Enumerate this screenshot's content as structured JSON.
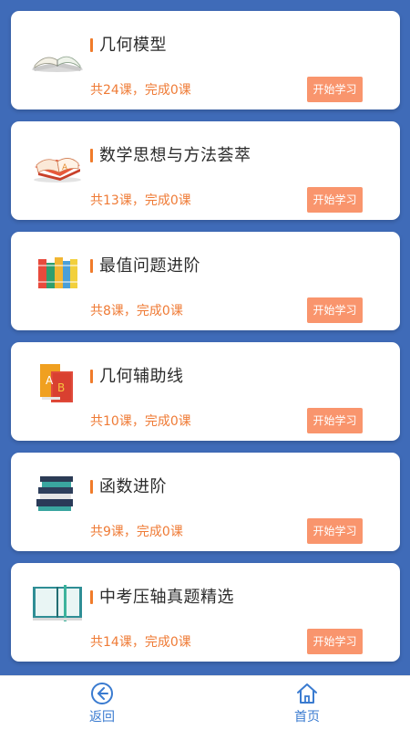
{
  "courses": [
    {
      "title": "几何模型",
      "progress": "共24课，完成0课",
      "button": "开始学习",
      "icon": "open-book-icon"
    },
    {
      "title": "数学思想与方法荟萃",
      "progress": "共13课，完成0课",
      "button": "开始学习",
      "icon": "open-red-book-icon"
    },
    {
      "title": "最值问题进阶",
      "progress": "共8课，完成0课",
      "button": "开始学习",
      "icon": "books-row-icon"
    },
    {
      "title": "几何辅助线",
      "progress": "共10课，完成0课",
      "button": "开始学习",
      "icon": "ab-books-icon"
    },
    {
      "title": "函数进阶",
      "progress": "共9课，完成0课",
      "button": "开始学习",
      "icon": "book-stack-icon"
    },
    {
      "title": "中考压轴真题精选",
      "progress": "共14课，完成0课",
      "button": "开始学习",
      "icon": "open-teal-book-icon"
    }
  ],
  "nav": {
    "back_label": "返回",
    "home_label": "首页",
    "back_icon": "back-arrow-circle-icon",
    "home_icon": "home-icon"
  },
  "colors": {
    "background": "#3f6bb8",
    "accent_orange": "#f07b2a",
    "button": "#f9956d",
    "nav_blue": "#3a7bd0"
  }
}
